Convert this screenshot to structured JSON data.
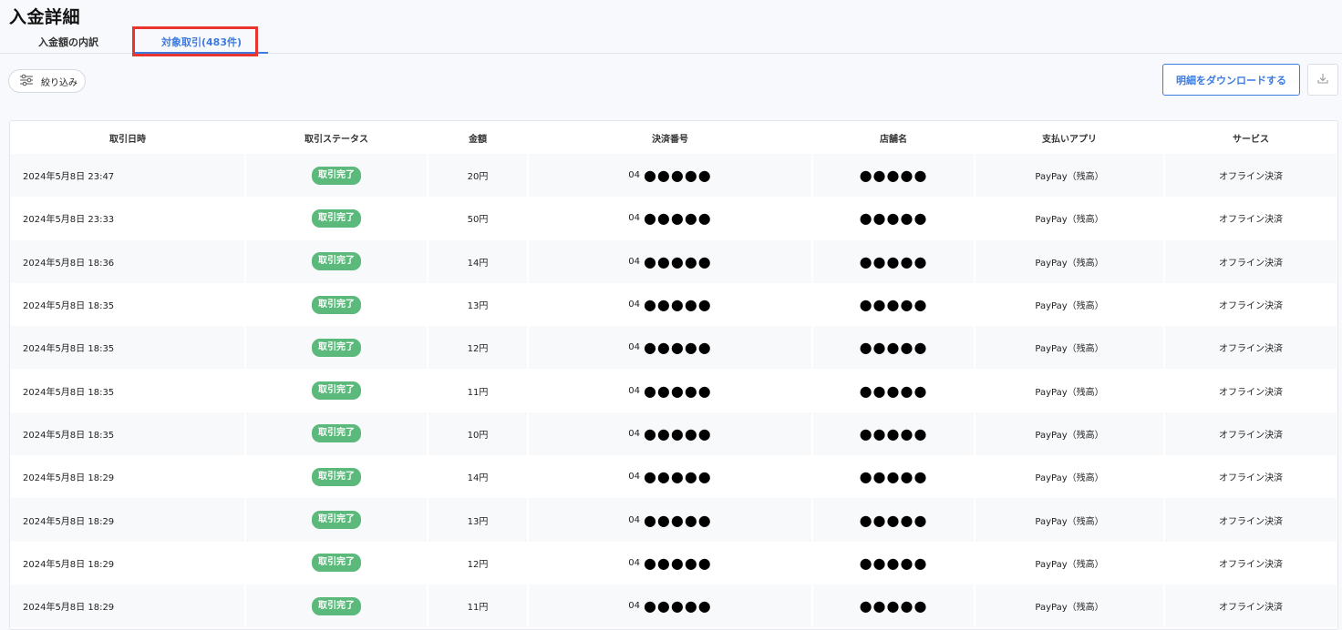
{
  "page_title": "入金詳細",
  "tabs": [
    {
      "label": "入金額の内訳"
    },
    {
      "label": "対象取引(483件)"
    }
  ],
  "toolbar": {
    "filter_label": "絞り込み",
    "download_label": "明細をダウンロードする"
  },
  "icons": {
    "filter": "sliders-icon",
    "download": "download-icon"
  },
  "colors": {
    "accent": "#3d7be0",
    "badge": "#5bb97b",
    "highlight": "#e8342c"
  },
  "table": {
    "headers": [
      "取引日時",
      "取引ステータス",
      "金額",
      "決済番号",
      "店舗名",
      "支払いアプリ",
      "サービス"
    ],
    "rows": [
      {
        "datetime": "2024年5月8日 23:47",
        "status": "取引完了",
        "amount": "20円",
        "pay_prefix": "04",
        "pay_masked": "●●●●●",
        "store": "●●●●●",
        "app": "PayPay（残高）",
        "service": "オフライン決済"
      },
      {
        "datetime": "2024年5月8日 23:33",
        "status": "取引完了",
        "amount": "50円",
        "pay_prefix": "04",
        "pay_masked": "●●●●●",
        "store": "●●●●●",
        "app": "PayPay（残高）",
        "service": "オフライン決済"
      },
      {
        "datetime": "2024年5月8日 18:36",
        "status": "取引完了",
        "amount": "14円",
        "pay_prefix": "04",
        "pay_masked": "●●●●●",
        "store": "●●●●●",
        "app": "PayPay（残高）",
        "service": "オフライン決済"
      },
      {
        "datetime": "2024年5月8日 18:35",
        "status": "取引完了",
        "amount": "13円",
        "pay_prefix": "04",
        "pay_masked": "●●●●●",
        "store": "●●●●●",
        "app": "PayPay（残高）",
        "service": "オフライン決済"
      },
      {
        "datetime": "2024年5月8日 18:35",
        "status": "取引完了",
        "amount": "12円",
        "pay_prefix": "04",
        "pay_masked": "●●●●●",
        "store": "●●●●●",
        "app": "PayPay（残高）",
        "service": "オフライン決済"
      },
      {
        "datetime": "2024年5月8日 18:35",
        "status": "取引完了",
        "amount": "11円",
        "pay_prefix": "04",
        "pay_masked": "●●●●●",
        "store": "●●●●●",
        "app": "PayPay（残高）",
        "service": "オフライン決済"
      },
      {
        "datetime": "2024年5月8日 18:35",
        "status": "取引完了",
        "amount": "10円",
        "pay_prefix": "04",
        "pay_masked": "●●●●●",
        "store": "●●●●●",
        "app": "PayPay（残高）",
        "service": "オフライン決済"
      },
      {
        "datetime": "2024年5月8日 18:29",
        "status": "取引完了",
        "amount": "14円",
        "pay_prefix": "04",
        "pay_masked": "●●●●●",
        "store": "●●●●●",
        "app": "PayPay（残高）",
        "service": "オフライン決済"
      },
      {
        "datetime": "2024年5月8日 18:29",
        "status": "取引完了",
        "amount": "13円",
        "pay_prefix": "04",
        "pay_masked": "●●●●●",
        "store": "●●●●●",
        "app": "PayPay（残高）",
        "service": "オフライン決済"
      },
      {
        "datetime": "2024年5月8日 18:29",
        "status": "取引完了",
        "amount": "12円",
        "pay_prefix": "04",
        "pay_masked": "●●●●●",
        "store": "●●●●●",
        "app": "PayPay（残高）",
        "service": "オフライン決済"
      },
      {
        "datetime": "2024年5月8日 18:29",
        "status": "取引完了",
        "amount": "11円",
        "pay_prefix": "04",
        "pay_masked": "●●●●●",
        "store": "●●●●●",
        "app": "PayPay（残高）",
        "service": "オフライン決済"
      }
    ]
  }
}
